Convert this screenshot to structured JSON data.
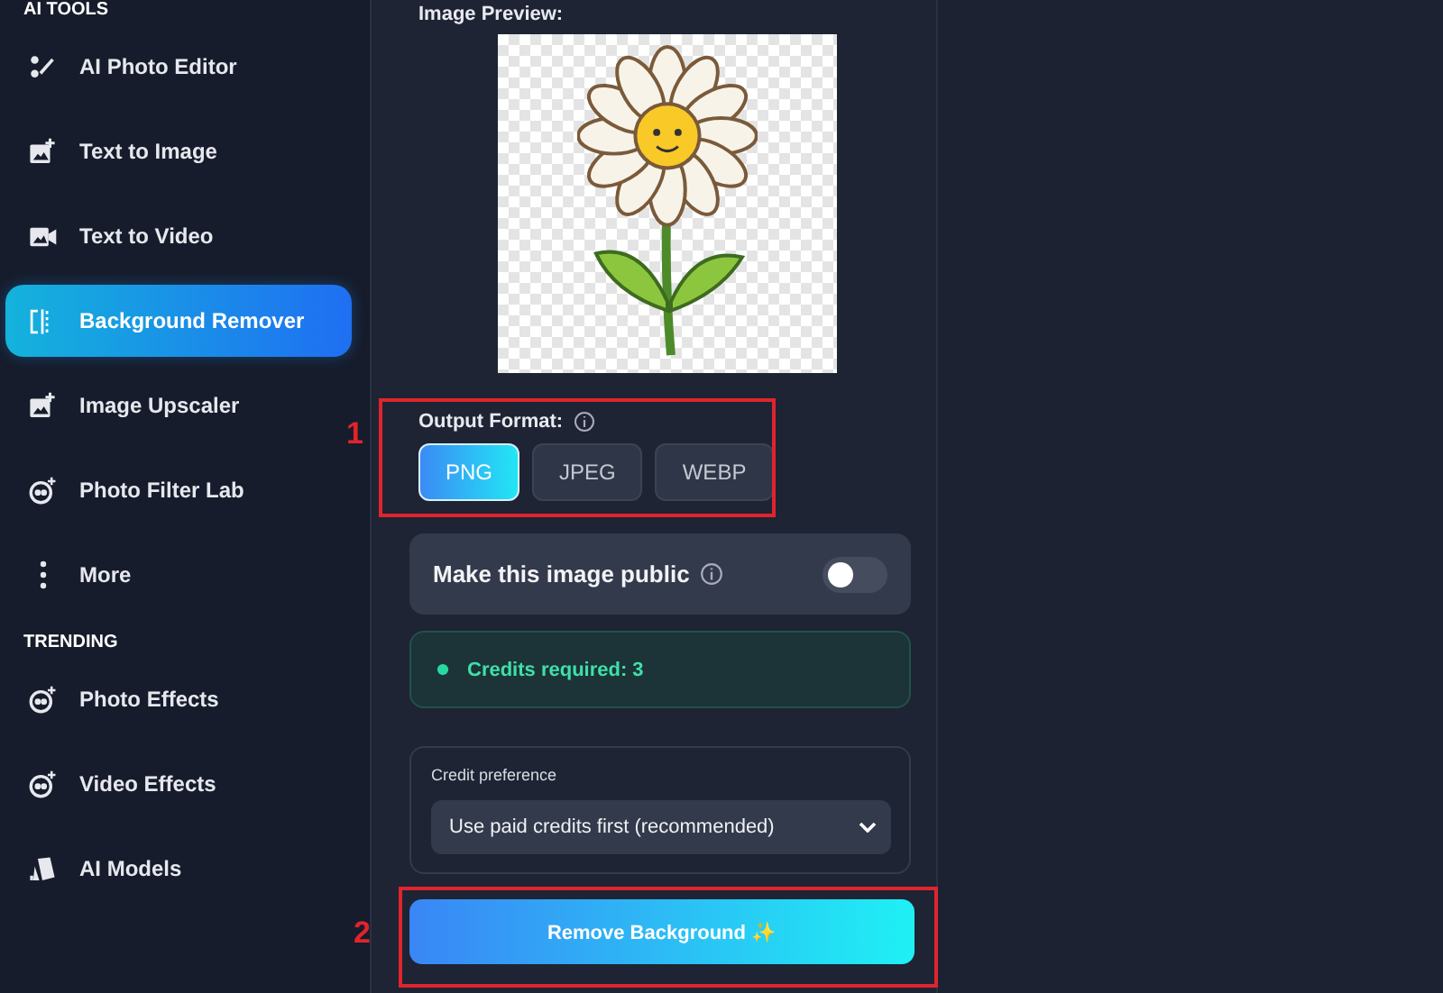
{
  "sidebar": {
    "sections": [
      {
        "heading": "AI TOOLS",
        "items": [
          {
            "label": "AI Photo Editor",
            "kind": "wand",
            "selected": false
          },
          {
            "label": "Text to Image",
            "kind": "image",
            "selected": false
          },
          {
            "label": "Text to Video",
            "kind": "video",
            "selected": false
          },
          {
            "label": "Background Remover",
            "kind": "split",
            "selected": true
          },
          {
            "label": "Image Upscaler",
            "kind": "image",
            "selected": false
          },
          {
            "label": "Photo Filter Lab",
            "kind": "face",
            "selected": false
          },
          {
            "label": "More",
            "kind": "dots",
            "selected": false
          }
        ]
      },
      {
        "heading": "TRENDING",
        "items": [
          {
            "label": "Photo Effects",
            "kind": "face",
            "selected": false
          },
          {
            "label": "Video Effects",
            "kind": "face",
            "selected": false
          },
          {
            "label": "AI Models",
            "kind": "cards",
            "selected": false
          }
        ]
      }
    ]
  },
  "preview": {
    "label": "Image Preview:"
  },
  "output_format": {
    "label": "Output Format:",
    "options": [
      {
        "label": "PNG",
        "selected": true
      },
      {
        "label": "JPEG",
        "selected": false
      },
      {
        "label": "WEBP",
        "selected": false
      }
    ]
  },
  "public_toggle": {
    "label": "Make this image public",
    "on": false
  },
  "credits": {
    "text": "Credits required: 3"
  },
  "credit_preference": {
    "label": "Credit preference",
    "value": "Use paid credits first (recommended)"
  },
  "action_button": {
    "label": "Remove Background ✨"
  },
  "annotations": [
    {
      "label": "1"
    },
    {
      "label": "2"
    }
  ]
}
